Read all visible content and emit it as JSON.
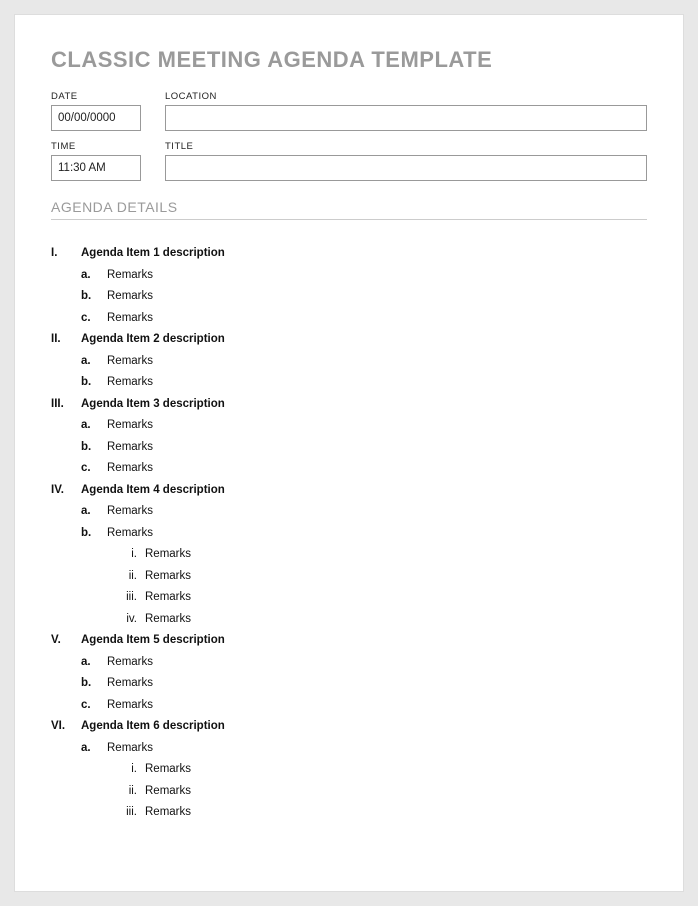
{
  "title": "CLASSIC MEETING AGENDA TEMPLATE",
  "fields": {
    "date_label": "DATE",
    "date_value": "00/00/0000",
    "location_label": "LOCATION",
    "location_value": "",
    "time_label": "TIME",
    "time_value": "11:30 AM",
    "title_label": "TITLE",
    "title_value": ""
  },
  "section_heading": "AGENDA DETAILS",
  "agenda": [
    {
      "marker": "I.",
      "text": "Agenda Item 1 description",
      "children": [
        {
          "marker": "a.",
          "text": "Remarks"
        },
        {
          "marker": "b.",
          "text": "Remarks"
        },
        {
          "marker": "c.",
          "text": "Remarks"
        }
      ]
    },
    {
      "marker": "II.",
      "text": "Agenda Item 2 description",
      "children": [
        {
          "marker": "a.",
          "text": "Remarks"
        },
        {
          "marker": "b.",
          "text": "Remarks"
        }
      ]
    },
    {
      "marker": "III.",
      "text": "Agenda Item 3 description",
      "children": [
        {
          "marker": "a.",
          "text": "Remarks"
        },
        {
          "marker": "b.",
          "text": "Remarks"
        },
        {
          "marker": "c.",
          "text": "Remarks"
        }
      ]
    },
    {
      "marker": "IV.",
      "text": "Agenda Item 4 description",
      "children": [
        {
          "marker": "a.",
          "text": "Remarks"
        },
        {
          "marker": "b.",
          "text": "Remarks",
          "children": [
            {
              "marker": "i.",
              "text": "Remarks"
            },
            {
              "marker": "ii.",
              "text": "Remarks"
            },
            {
              "marker": "iii.",
              "text": "Remarks"
            },
            {
              "marker": "iv.",
              "text": "Remarks"
            }
          ]
        }
      ]
    },
    {
      "marker": "V.",
      "text": "Agenda Item 5 description",
      "children": [
        {
          "marker": "a.",
          "text": "Remarks"
        },
        {
          "marker": "b.",
          "text": "Remarks"
        },
        {
          "marker": "c.",
          "text": "Remarks"
        }
      ]
    },
    {
      "marker": "VI.",
      "text": "Agenda Item 6 description",
      "children": [
        {
          "marker": "a.",
          "text": "Remarks",
          "children": [
            {
              "marker": "i.",
              "text": "Remarks"
            },
            {
              "marker": "ii.",
              "text": "Remarks"
            },
            {
              "marker": "iii.",
              "text": "Remarks"
            }
          ]
        }
      ]
    }
  ]
}
